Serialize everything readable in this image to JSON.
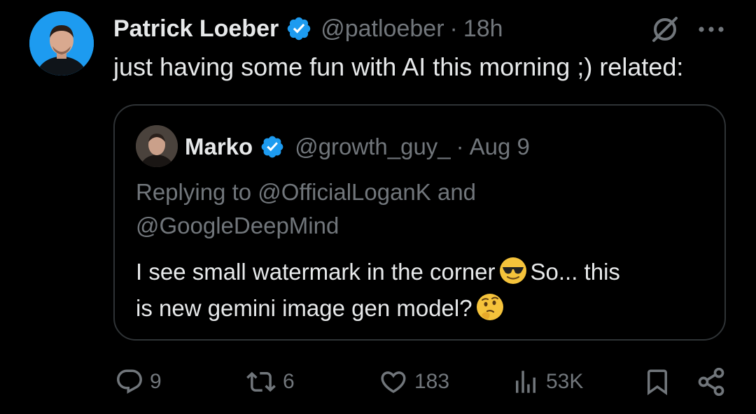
{
  "tweet": {
    "author_name": "Patrick Loeber",
    "handle": "@patloeber",
    "separator": "·",
    "time": "18h",
    "text": "just having some fun with AI this morning ;) related:"
  },
  "quoted_tweet": {
    "author_name": "Marko",
    "handle": "@growth_guy_",
    "separator": "·",
    "time": "Aug 9",
    "replying_line1": "Replying to @OfficialLoganK and",
    "replying_line2": "@GoogleDeepMind",
    "text_part1": "I see small watermark in the corner",
    "text_part2": "So... this",
    "text_part3": "is new gemini image gen model?"
  },
  "actions": {
    "replies": "9",
    "reposts": "6",
    "likes": "183",
    "views": "53K"
  },
  "colors": {
    "background": "#000000",
    "primary_text": "#e7e9ea",
    "secondary_text": "#71767b",
    "verified_blue": "#1d9bf0",
    "border": "#2f3336"
  },
  "icons": {
    "verified": "verified-badge-icon",
    "grok": "grok-icon",
    "more": "more-horizontal-icon",
    "reply": "reply-bubble-icon",
    "repost": "repost-arrows-icon",
    "like": "heart-icon",
    "views": "analytics-bars-icon",
    "bookmark": "bookmark-icon",
    "share": "share-icon"
  }
}
